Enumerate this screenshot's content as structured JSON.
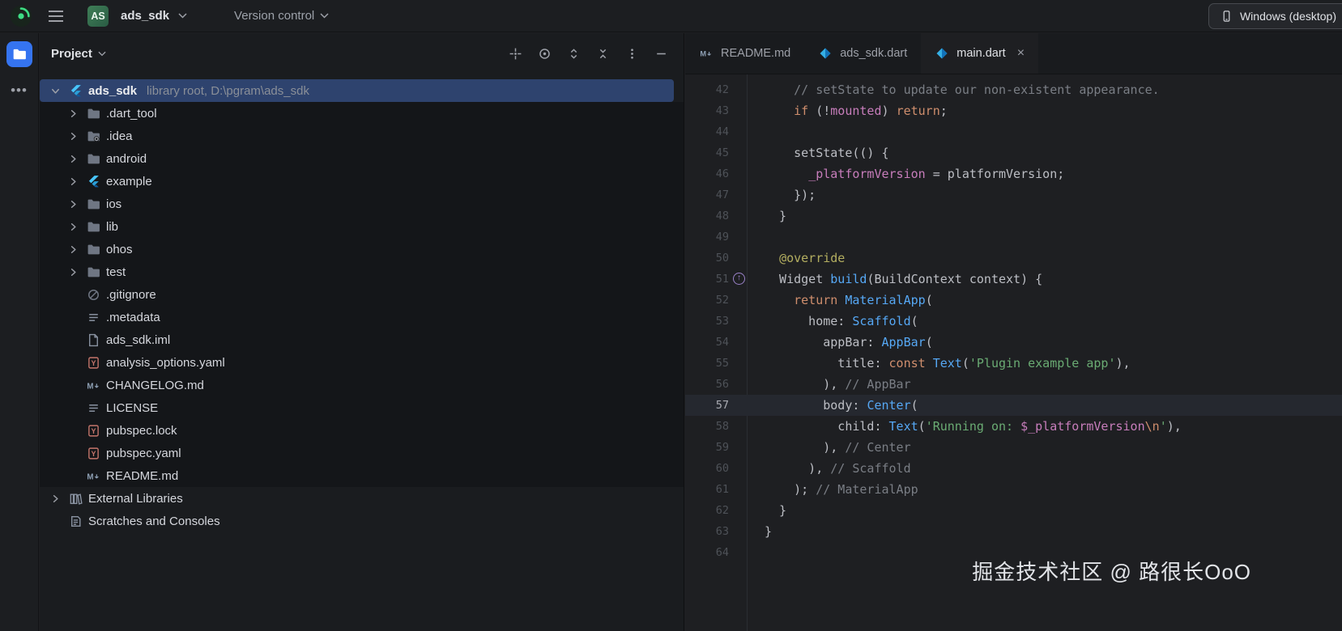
{
  "topbar": {
    "project_badge": "AS",
    "project_name": "ads_sdk",
    "version_control": "Version control",
    "device_selector": "Windows (desktop)"
  },
  "project_panel": {
    "title": "Project",
    "toolbar": [
      {
        "name": "select-opened-file",
        "glyph": "crosshair"
      },
      {
        "name": "locate",
        "glyph": "target"
      },
      {
        "name": "expand-all",
        "glyph": "expand"
      },
      {
        "name": "collapse-all",
        "glyph": "collapse"
      },
      {
        "name": "options",
        "glyph": "kebab"
      },
      {
        "name": "hide-panel",
        "glyph": "minus"
      }
    ],
    "tree": [
      {
        "label": "ads_sdk",
        "suffix": "library root,  D:\\pgram\\ads_sdk",
        "icon": "flutter",
        "chevron": "open",
        "indent": 0,
        "selected": true,
        "bold": true,
        "block": "root"
      },
      {
        "label": ".dart_tool",
        "icon": "folder",
        "chevron": "closed",
        "indent": 1,
        "block": "inner"
      },
      {
        "label": ".idea",
        "icon": "folder-idea",
        "chevron": "closed",
        "indent": 1,
        "block": "inner"
      },
      {
        "label": "android",
        "icon": "folder",
        "chevron": "closed",
        "indent": 1,
        "block": "inner"
      },
      {
        "label": "example",
        "icon": "flutter",
        "chevron": "closed",
        "indent": 1,
        "block": "inner"
      },
      {
        "label": "ios",
        "icon": "folder",
        "chevron": "closed",
        "indent": 1,
        "block": "inner"
      },
      {
        "label": "lib",
        "icon": "folder",
        "chevron": "closed",
        "indent": 1,
        "block": "inner"
      },
      {
        "label": "ohos",
        "icon": "folder",
        "chevron": "closed",
        "indent": 1,
        "block": "inner"
      },
      {
        "label": "test",
        "icon": "folder",
        "chevron": "closed",
        "indent": 1,
        "block": "inner"
      },
      {
        "label": ".gitignore",
        "icon": "git",
        "chevron": "none",
        "indent": 1,
        "block": "inner"
      },
      {
        "label": ".metadata",
        "icon": "text",
        "chevron": "none",
        "indent": 1,
        "block": "inner"
      },
      {
        "label": "ads_sdk.iml",
        "icon": "iml",
        "chevron": "none",
        "indent": 1,
        "block": "inner"
      },
      {
        "label": "analysis_options.yaml",
        "icon": "yaml",
        "chevron": "none",
        "indent": 1,
        "block": "inner"
      },
      {
        "label": "CHANGELOG.md",
        "icon": "markdown",
        "chevron": "none",
        "indent": 1,
        "block": "inner"
      },
      {
        "label": "LICENSE",
        "icon": "text",
        "chevron": "none",
        "indent": 1,
        "block": "inner"
      },
      {
        "label": "pubspec.lock",
        "icon": "yaml",
        "chevron": "none",
        "indent": 1,
        "block": "inner"
      },
      {
        "label": "pubspec.yaml",
        "icon": "yaml",
        "chevron": "none",
        "indent": 1,
        "block": "inner"
      },
      {
        "label": "README.md",
        "icon": "markdown",
        "chevron": "none",
        "indent": 1,
        "block": "inner"
      },
      {
        "label": "External Libraries",
        "icon": "libraries",
        "chevron": "closed",
        "indent": 0,
        "block": "outer"
      },
      {
        "label": "Scratches and Consoles",
        "icon": "scratches",
        "chevron": "none",
        "indent": 0,
        "block": "outer"
      }
    ]
  },
  "editor": {
    "tabs": [
      {
        "label": "README.md",
        "icon": "markdown",
        "active": false,
        "closable": false
      },
      {
        "label": "ads_sdk.dart",
        "icon": "dart",
        "active": false,
        "closable": false
      },
      {
        "label": "main.dart",
        "icon": "dart",
        "active": true,
        "closable": true
      }
    ],
    "close_glyph": "×",
    "code_lines": [
      {
        "n": 42,
        "seg": [
          [
            "    // setState to update our non-existent appearance.",
            "com"
          ]
        ]
      },
      {
        "n": 43,
        "seg": [
          [
            "    ",
            "d"
          ],
          [
            "if",
            "kw"
          ],
          [
            " (!",
            "d"
          ],
          [
            "mounted",
            "fld"
          ],
          [
            ") ",
            "d"
          ],
          [
            "return",
            "kw"
          ],
          [
            ";",
            "d"
          ]
        ]
      },
      {
        "n": 44,
        "seg": []
      },
      {
        "n": 45,
        "seg": [
          [
            "    setState(() {",
            "d"
          ]
        ]
      },
      {
        "n": 46,
        "seg": [
          [
            "      ",
            "d"
          ],
          [
            "_platformVersion",
            "fld"
          ],
          [
            " = platformVersion;",
            "d"
          ]
        ]
      },
      {
        "n": 47,
        "seg": [
          [
            "    });",
            "d"
          ]
        ]
      },
      {
        "n": 48,
        "seg": [
          [
            "  }",
            "d"
          ]
        ]
      },
      {
        "n": 49,
        "seg": []
      },
      {
        "n": 50,
        "seg": [
          [
            "  ",
            "d"
          ],
          [
            "@override",
            "ann"
          ]
        ]
      },
      {
        "n": 51,
        "gutter_icon": "overriding-method",
        "seg": [
          [
            "  Widget ",
            "d"
          ],
          [
            "build",
            "fn"
          ],
          [
            "(BuildContext context) {",
            "d"
          ]
        ]
      },
      {
        "n": 52,
        "seg": [
          [
            "    ",
            "d"
          ],
          [
            "return",
            "kw"
          ],
          [
            " ",
            "d"
          ],
          [
            "MaterialApp",
            "cls"
          ],
          [
            "(",
            "d"
          ]
        ]
      },
      {
        "n": 53,
        "seg": [
          [
            "      home: ",
            "d"
          ],
          [
            "Scaffold",
            "cls"
          ],
          [
            "(",
            "d"
          ]
        ]
      },
      {
        "n": 54,
        "seg": [
          [
            "        appBar: ",
            "d"
          ],
          [
            "AppBar",
            "cls"
          ],
          [
            "(",
            "d"
          ]
        ]
      },
      {
        "n": 55,
        "seg": [
          [
            "          title: ",
            "d"
          ],
          [
            "const",
            "kw"
          ],
          [
            " ",
            "d"
          ],
          [
            "Text",
            "cls"
          ],
          [
            "(",
            "d"
          ],
          [
            "'Plugin example app'",
            "str"
          ],
          [
            "),",
            "d"
          ]
        ]
      },
      {
        "n": 56,
        "seg": [
          [
            "        ), ",
            "d"
          ],
          [
            "// AppBar",
            "com"
          ]
        ]
      },
      {
        "n": 57,
        "current": true,
        "seg": [
          [
            "        body: ",
            "d"
          ],
          [
            "Center",
            "cls"
          ],
          [
            "(",
            "d"
          ]
        ]
      },
      {
        "n": 58,
        "seg": [
          [
            "          child: ",
            "d"
          ],
          [
            "Text",
            "cls"
          ],
          [
            "(",
            "d"
          ],
          [
            "'Running on: ",
            "str"
          ],
          [
            "$_platformVersion",
            "fld"
          ],
          [
            "\\n",
            "esc"
          ],
          [
            "'",
            "str"
          ],
          [
            "),",
            "d"
          ]
        ]
      },
      {
        "n": 59,
        "seg": [
          [
            "        ), ",
            "d"
          ],
          [
            "// Center",
            "com"
          ]
        ]
      },
      {
        "n": 60,
        "seg": [
          [
            "      ), ",
            "d"
          ],
          [
            "// Scaffold",
            "com"
          ]
        ]
      },
      {
        "n": 61,
        "seg": [
          [
            "    ); ",
            "d"
          ],
          [
            "// MaterialApp",
            "com"
          ]
        ]
      },
      {
        "n": 62,
        "seg": [
          [
            "  }",
            "d"
          ]
        ]
      },
      {
        "n": 63,
        "seg": [
          [
            "}",
            "d"
          ]
        ]
      },
      {
        "n": 64,
        "seg": []
      }
    ]
  },
  "watermark": "掘金技术社区 @ 路很长OoO"
}
